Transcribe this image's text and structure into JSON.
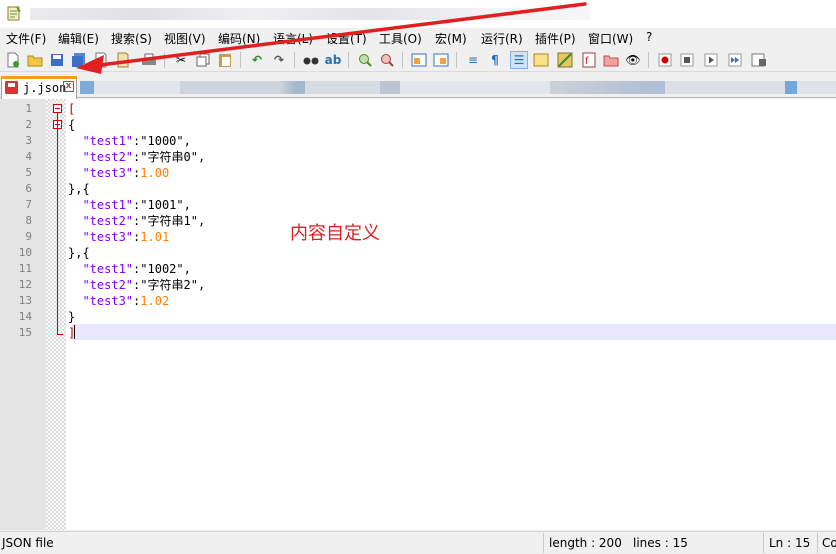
{
  "menu": [
    {
      "id": "file",
      "label": "文件(F)"
    },
    {
      "id": "edit",
      "label": "编辑(E)"
    },
    {
      "id": "search",
      "label": "搜索(S)"
    },
    {
      "id": "view",
      "label": "视图(V)"
    },
    {
      "id": "encoding",
      "label": "编码(N)"
    },
    {
      "id": "language",
      "label": "语言(L)"
    },
    {
      "id": "settings",
      "label": "设置(T)"
    },
    {
      "id": "tools",
      "label": "工具(O)"
    },
    {
      "id": "macro",
      "label": "宏(M)"
    },
    {
      "id": "run",
      "label": "运行(R)"
    },
    {
      "id": "plugins",
      "label": "插件(P)"
    },
    {
      "id": "window",
      "label": "窗口(W)"
    },
    {
      "id": "help",
      "label": "?"
    }
  ],
  "tab": {
    "filename": "j.json",
    "close_glyph": "x"
  },
  "editor": {
    "line_numbers": [
      "1",
      "2",
      "3",
      "4",
      "5",
      "6",
      "7",
      "8",
      "9",
      "10",
      "11",
      "12",
      "13",
      "14",
      "15"
    ],
    "lines": [
      "[",
      "{",
      "  \"test1\":\"1000\",",
      "  \"test2\":\"字符串0\",",
      "  \"test3\":1.00",
      "},{",
      "  \"test1\":\"1001\",",
      "  \"test2\":\"字符串1\",",
      "  \"test3\":1.01",
      "},{",
      "  \"test1\":\"1002\",",
      "  \"test2\":\"字符串2\",",
      "  \"test3\":1.02",
      "}",
      "]"
    ],
    "current_line": 15
  },
  "annotation": "内容自定义",
  "status": {
    "file_type": "JSON file",
    "length": "length : 200",
    "lines": "lines : 15",
    "position": "Ln : 15",
    "col_partial": "Co"
  },
  "colors": {
    "annotation": "#e02020",
    "key": "#8000ff",
    "number": "#ff8000",
    "brace": "#d00000",
    "tab_accent": "#fa9d1a"
  }
}
